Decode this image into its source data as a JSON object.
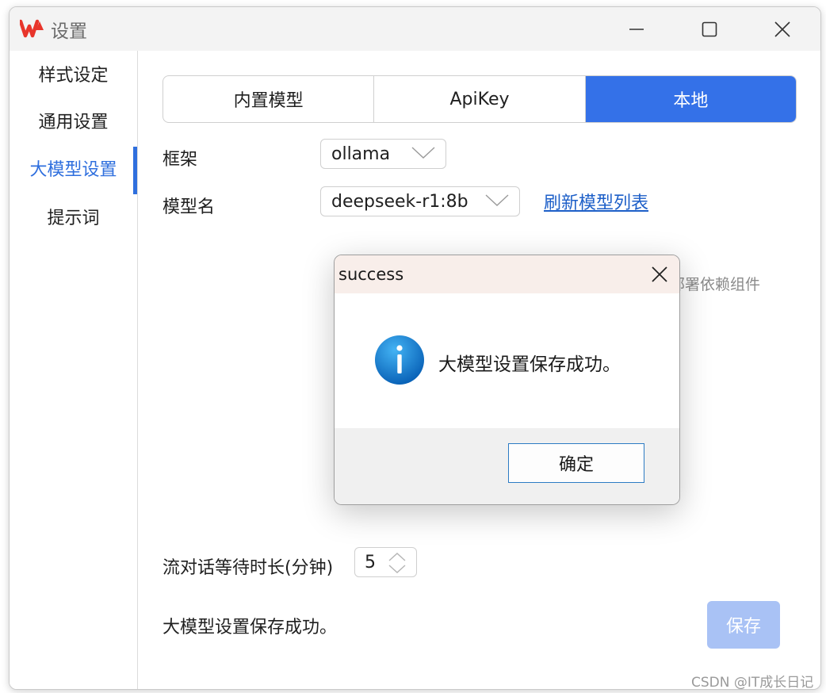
{
  "window": {
    "title": "设置",
    "logo_icon": "wps-logo-icon",
    "brand_color": "#e8352b"
  },
  "sidebar": {
    "items": [
      {
        "label": "样式设定"
      },
      {
        "label": "通用设置"
      },
      {
        "label": "大模型设置",
        "active": true
      },
      {
        "label": "提示词"
      }
    ],
    "accent_color": "#2f6fde"
  },
  "tabs": [
    {
      "label": "内置模型"
    },
    {
      "label": "ApiKey"
    },
    {
      "label": "本地",
      "active": true
    }
  ],
  "form": {
    "framework_label": "框架",
    "framework_value": "ollama",
    "model_label": "模型名",
    "model_value": "deepseek-r1:8b",
    "refresh_link": "刷新模型列表",
    "partial_hint": "部署依赖组件",
    "wait_label": "流对话等待时长(分钟)",
    "wait_value": "5"
  },
  "status_text": "大模型设置保存成功。",
  "save_label": "保存",
  "dialog": {
    "title": "success",
    "icon": "info-icon",
    "message": "大模型设置保存成功。",
    "ok_label": "确定"
  },
  "watermark": "CSDN @IT成长日记"
}
